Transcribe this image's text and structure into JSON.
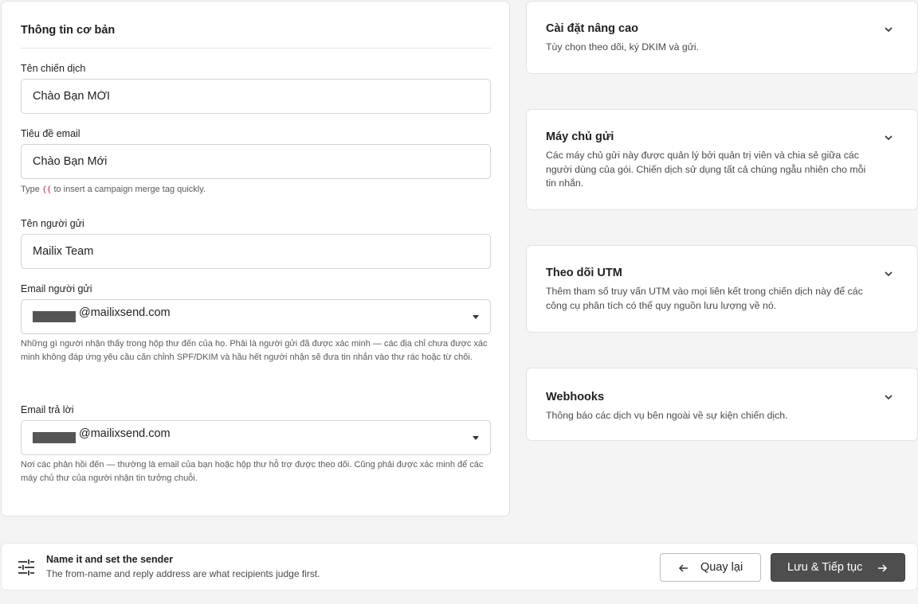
{
  "basic": {
    "title": "Thông tin cơ bản",
    "campaign_name_label": "Tên chiến dịch",
    "campaign_name_value": "Chào Bạn MỚI",
    "subject_label": "Tiêu đề email",
    "subject_value": "Chào Bạn Mới",
    "subject_help_prefix": "Type",
    "subject_help_tag": "{{",
    "subject_help_suffix": "to insert a campaign merge tag quickly.",
    "sender_name_label": "Tên người gửi",
    "sender_name_value": "Mailix Team",
    "sender_email_label": "Email người gửi",
    "sender_email_domain": "@mailixsend.com",
    "sender_email_help": "Những gì người nhận thấy trong hộp thư đến của họ. Phải là người gửi đã được xác minh — các địa chỉ chưa được xác minh không đáp ứng yêu cầu căn chỉnh SPF/DKIM và hầu hết người nhận sẽ đưa tin nhắn vào thư rác hoặc từ chối.",
    "reply_email_label": "Email trả lời",
    "reply_email_domain": "@mailixsend.com",
    "reply_email_help": "Nơi các phản hồi đến — thường là email của bạn hoặc hộp thư hỗ trợ được theo dõi. Cũng phải được xác minh để các máy chủ thư của người nhận tin tưởng chuỗi."
  },
  "side_cards": [
    {
      "title": "Cài đặt nâng cao",
      "description": "Tùy chọn theo dõi, ký DKIM và gửi."
    },
    {
      "title": "Máy chủ gửi",
      "description": "Các máy chủ gửi này được quản lý bởi quản trị viên và chia sẻ giữa các người dùng của gói. Chiến dịch sử dụng tất cả chúng ngẫu nhiên cho mỗi tin nhắn."
    },
    {
      "title": "Theo dõi UTM",
      "description": "Thêm tham số truy vấn UTM vào mọi liên kết trong chiến dịch này để các công cụ phân tích có thể quy nguồn lưu lượng về nó."
    },
    {
      "title": "Webhooks",
      "description": "Thông báo các dịch vụ bên ngoài về sự kiện chiến dịch."
    }
  ],
  "footer": {
    "title": "Name it and set the sender",
    "subtitle": "The from-name and reply address are what recipients judge first.",
    "back_label": "Quay lại",
    "save_label": "Lưu & Tiếp tục"
  },
  "icons": {
    "footer_icon": "tune-icon",
    "chevron": "chevron-down-icon",
    "back": "arrow-left-icon",
    "forward": "arrow-right-icon"
  },
  "colors": {
    "primary_button": "#4e4e4e",
    "merge_tag": "#c2185b"
  }
}
